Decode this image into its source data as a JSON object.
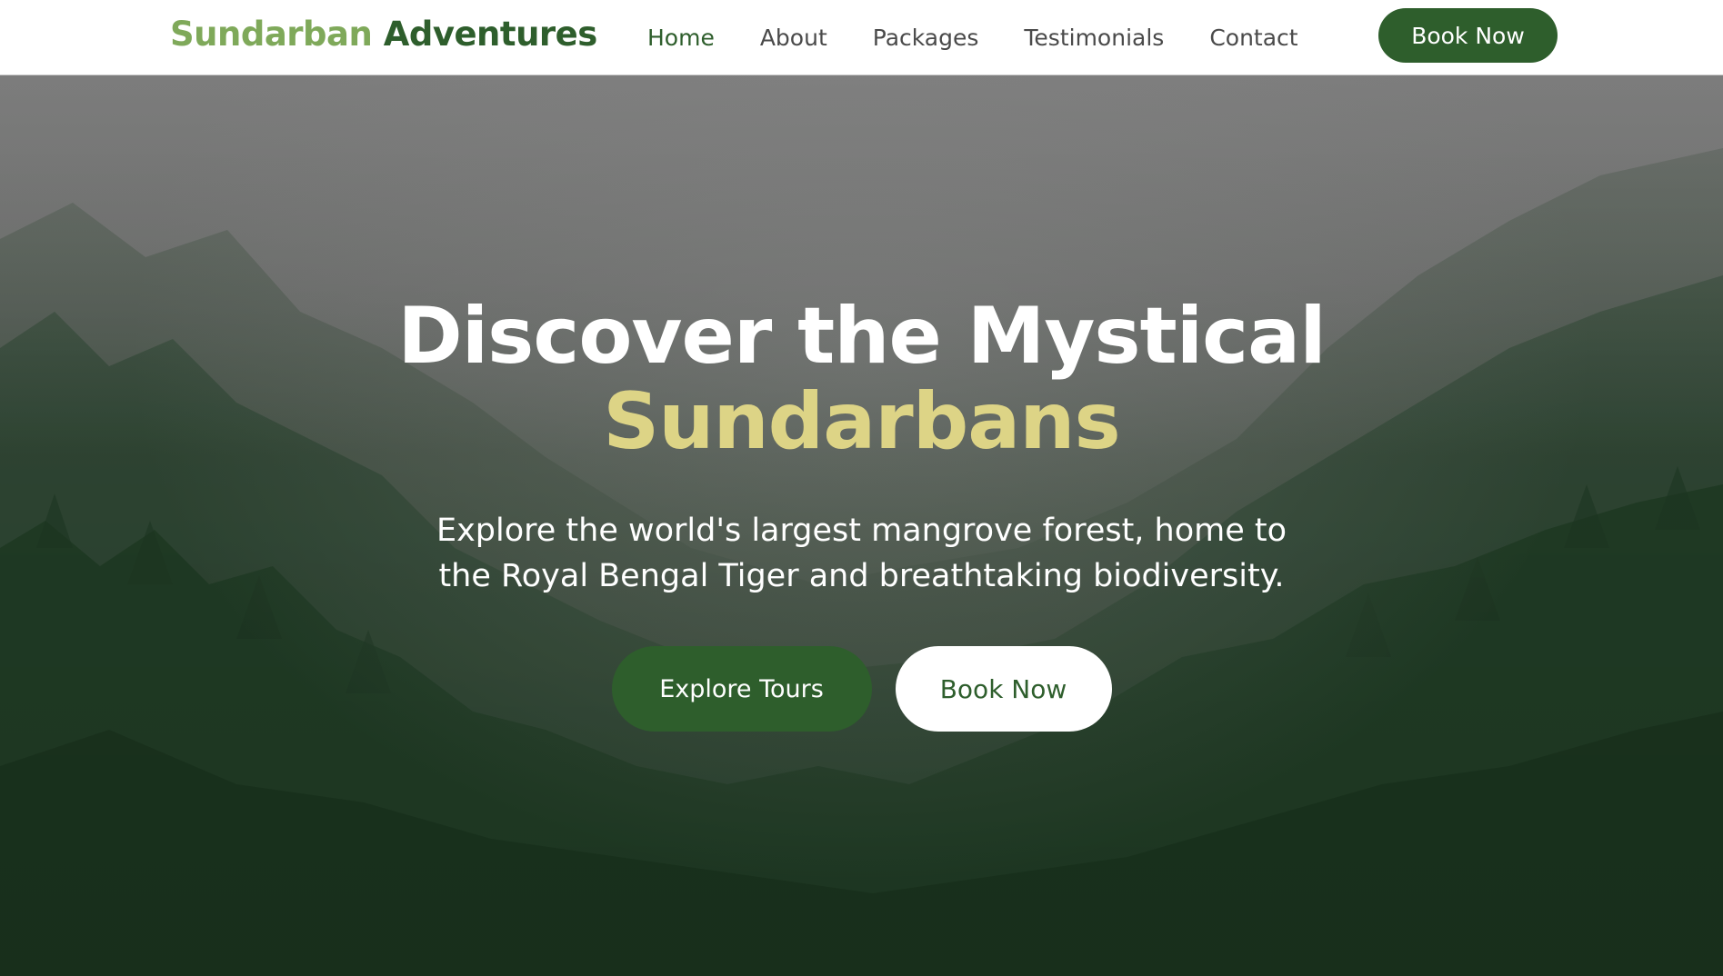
{
  "brand": {
    "name_first": "Sundarban",
    "name_second": "Adventures"
  },
  "nav": {
    "links": [
      {
        "label": "Home",
        "active": true
      },
      {
        "label": "About",
        "active": false
      },
      {
        "label": "Packages",
        "active": false
      },
      {
        "label": "Testimonials",
        "active": false
      },
      {
        "label": "Contact",
        "active": false
      }
    ],
    "book_label": "Book Now"
  },
  "hero": {
    "title_line1": "Discover the Mystical",
    "title_highlight": "Sundarbans",
    "subtitle": "Explore the world's largest mangrove forest, home to the Royal Bengal Tiger and breathtaking biodiversity.",
    "primary_button": "Explore Tours",
    "secondary_button": "Book Now",
    "background": "misty-pine-forest-photo"
  },
  "colors": {
    "brand_light_green": "#7fa95a",
    "brand_dark_green": "#2e5e2c",
    "highlight_yellow": "#ddd486",
    "white": "#ffffff"
  }
}
